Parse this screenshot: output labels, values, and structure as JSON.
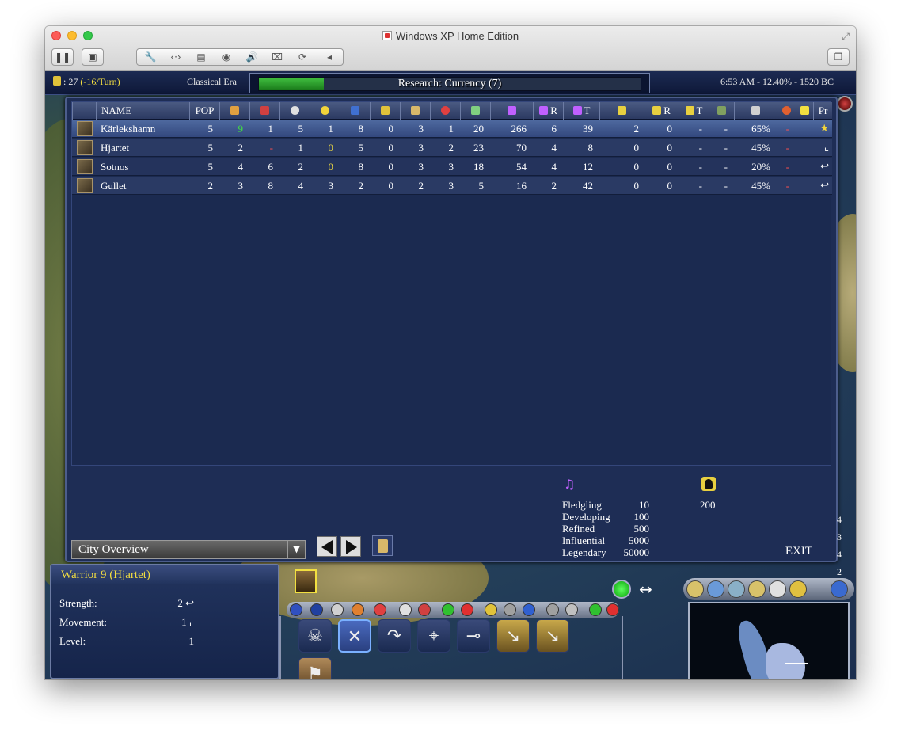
{
  "window": {
    "title": "Windows XP Home Edition"
  },
  "topbar": {
    "gold": ": 27",
    "gold_rate": "(-16/Turn)",
    "era": "Classical Era",
    "research": "Research: Currency (7)",
    "research_progress": 0.17,
    "clock": "6:53 AM - 12.40% - 1520 BC"
  },
  "table": {
    "headers": {
      "name": "NAME",
      "pop": "POP",
      "r": "R",
      "t": "T",
      "pr": "Pr"
    },
    "rows": [
      {
        "name": "Kärlekshamn",
        "pop": "5",
        "c1": "9",
        "c2": "1",
        "c3": "5",
        "c4": "1",
        "c5": "8",
        "c6": "0",
        "c7": "3",
        "c8": "1",
        "c9": "20",
        "c10": "266",
        "c11": "6",
        "c12": "39",
        "c13": "2",
        "c14": "0",
        "c15": "-",
        "c16": "-",
        "c17": "65%",
        "c18": "-"
      },
      {
        "name": "Hjartet",
        "pop": "5",
        "c1": "2",
        "c2": "-",
        "c3": "1",
        "c4": "0",
        "c5": "5",
        "c6": "0",
        "c7": "3",
        "c8": "2",
        "c9": "23",
        "c10": "70",
        "c11": "4",
        "c12": "8",
        "c13": "0",
        "c14": "0",
        "c15": "-",
        "c16": "-",
        "c17": "45%",
        "c18": "-"
      },
      {
        "name": "Sotnos",
        "pop": "5",
        "c1": "4",
        "c2": "6",
        "c3": "2",
        "c4": "0",
        "c5": "8",
        "c6": "0",
        "c7": "3",
        "c8": "3",
        "c9": "18",
        "c10": "54",
        "c11": "4",
        "c12": "12",
        "c13": "0",
        "c14": "0",
        "c15": "-",
        "c16": "-",
        "c17": "20%",
        "c18": "-"
      },
      {
        "name": "Gullet",
        "pop": "2",
        "c1": "3",
        "c2": "8",
        "c3": "4",
        "c4": "3",
        "c5": "2",
        "c6": "0",
        "c7": "2",
        "c8": "3",
        "c9": "5",
        "c10": "16",
        "c11": "2",
        "c12": "42",
        "c13": "0",
        "c14": "0",
        "c15": "-",
        "c16": "-",
        "c17": "45%",
        "c18": "-"
      }
    ]
  },
  "culture_legend": [
    {
      "label": "Fledgling",
      "value": "10"
    },
    {
      "label": "Developing",
      "value": "100"
    },
    {
      "label": "Refined",
      "value": "500"
    },
    {
      "label": "Influential",
      "value": "5000"
    },
    {
      "label": "Legendary",
      "value": "50000"
    }
  ],
  "influence_value": "200",
  "controls": {
    "dropdown": "City Overview",
    "exit": "EXIT"
  },
  "side_numbers": [
    "4",
    "3",
    "4",
    "2"
  ],
  "unit": {
    "title": "Warrior 9 (Hjartet)",
    "strength_label": "Strength:",
    "strength_value": "2",
    "movement_label": "Movement:",
    "movement_value": "1",
    "level_label": "Level:",
    "level_value": "1"
  },
  "colors": {
    "accent_yellow": "#f2dd40",
    "research_green": "#40c040",
    "panel_blue": "#1e2d55"
  }
}
